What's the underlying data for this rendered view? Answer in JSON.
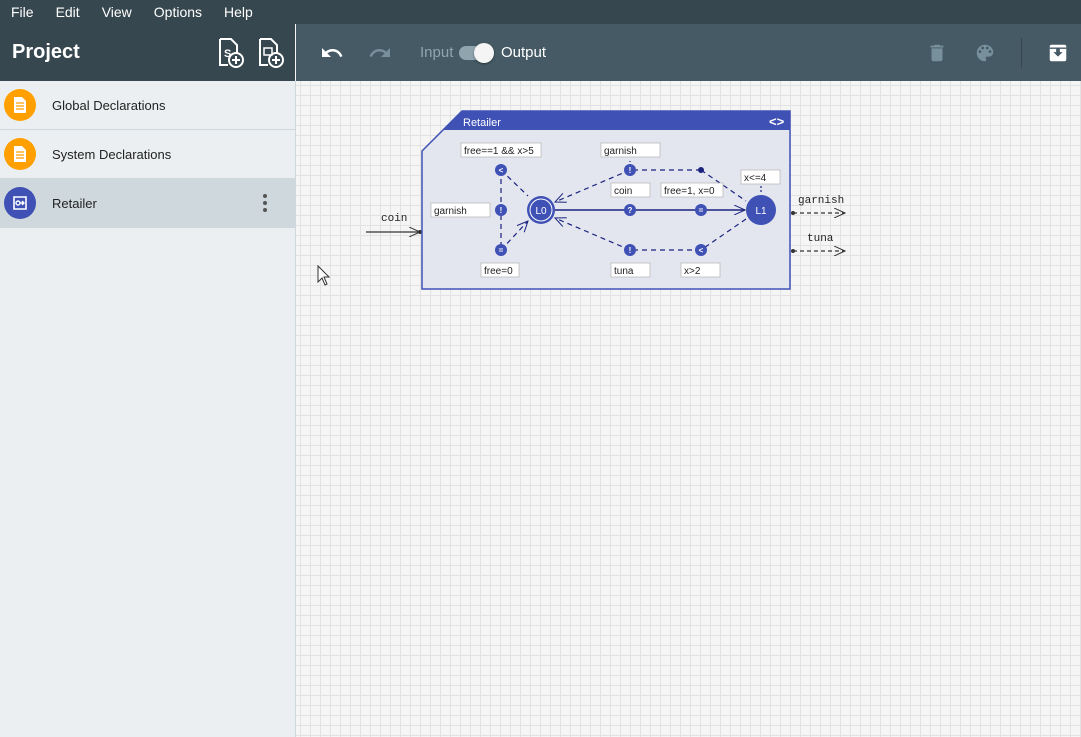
{
  "menubar": {
    "items": [
      "File",
      "Edit",
      "View",
      "Options",
      "Help"
    ]
  },
  "sidebar": {
    "title": "Project",
    "header_icons": [
      "add-system-declaration-icon",
      "add-component-icon"
    ],
    "items": [
      {
        "label": "Global Declarations",
        "icon": "document-icon",
        "color": "#ffa000",
        "selected": false
      },
      {
        "label": "System Declarations",
        "icon": "document-icon",
        "color": "#ffa000",
        "selected": false
      },
      {
        "label": "Retailer",
        "icon": "component-icon",
        "color": "#3f51b5",
        "selected": true
      }
    ]
  },
  "toolbar": {
    "input_label": "Input",
    "output_label": "Output",
    "mode": "Output",
    "icons": [
      "undo-icon",
      "redo-icon",
      "delete-icon",
      "palette-icon",
      "archive-icon"
    ]
  },
  "component": {
    "name": "Retailer",
    "color": "#3f51b5",
    "locations": [
      "L0",
      "L1"
    ],
    "input_signature": "coin",
    "output_signature": [
      "garnish",
      "tuna"
    ],
    "labels": {
      "guard_top_left": "free==1 && x>5",
      "garnish_left": "garnish",
      "update_bottom_left": "free=0",
      "garnish_top": "garnish",
      "coin": "coin",
      "update_middle": "free=1, x=0",
      "invariant": "x<=4",
      "tuna": "tuna",
      "guard_bottom": "x>2"
    },
    "nail_symbols": {
      "guard": "<",
      "output": "!",
      "input": "?",
      "update": "="
    }
  }
}
